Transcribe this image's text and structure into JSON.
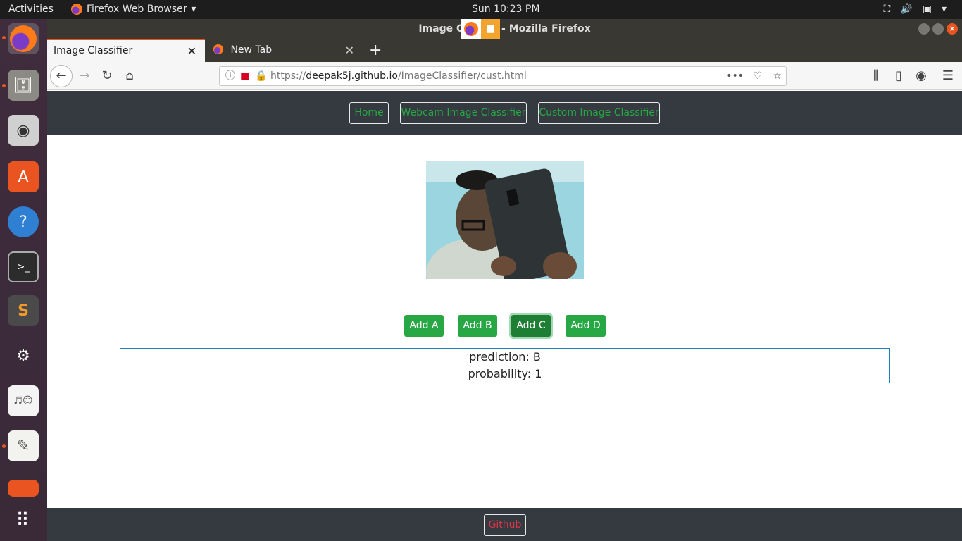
{
  "topbar": {
    "activities": "Activities",
    "app_name": "Firefox Web Browser",
    "clock": "Sun 10:23 PM"
  },
  "window": {
    "title": "Image C   r - Mozilla Firefox"
  },
  "tabs": [
    {
      "label": "Image Classifier"
    },
    {
      "label": "New Tab"
    }
  ],
  "url": {
    "scheme": "https://",
    "host": "deepak5j.github.io",
    "path": "/ImageClassifier/cust.html"
  },
  "site_nav": {
    "home": "Home",
    "webcam": "Webcam Image Classifier",
    "custom": "Custom Image Classifier"
  },
  "buttons": {
    "add_a": "Add A",
    "add_b": "Add B",
    "add_c": "Add C",
    "add_d": "Add D"
  },
  "result": {
    "prediction": "prediction: B",
    "probability": "probability: 1"
  },
  "footer": {
    "github": "Github"
  },
  "colors": {
    "accent": "#e95420",
    "nav_bg": "#343a40",
    "success": "#28a745",
    "danger": "#dc3545",
    "result_border": "#1d7fc4"
  }
}
